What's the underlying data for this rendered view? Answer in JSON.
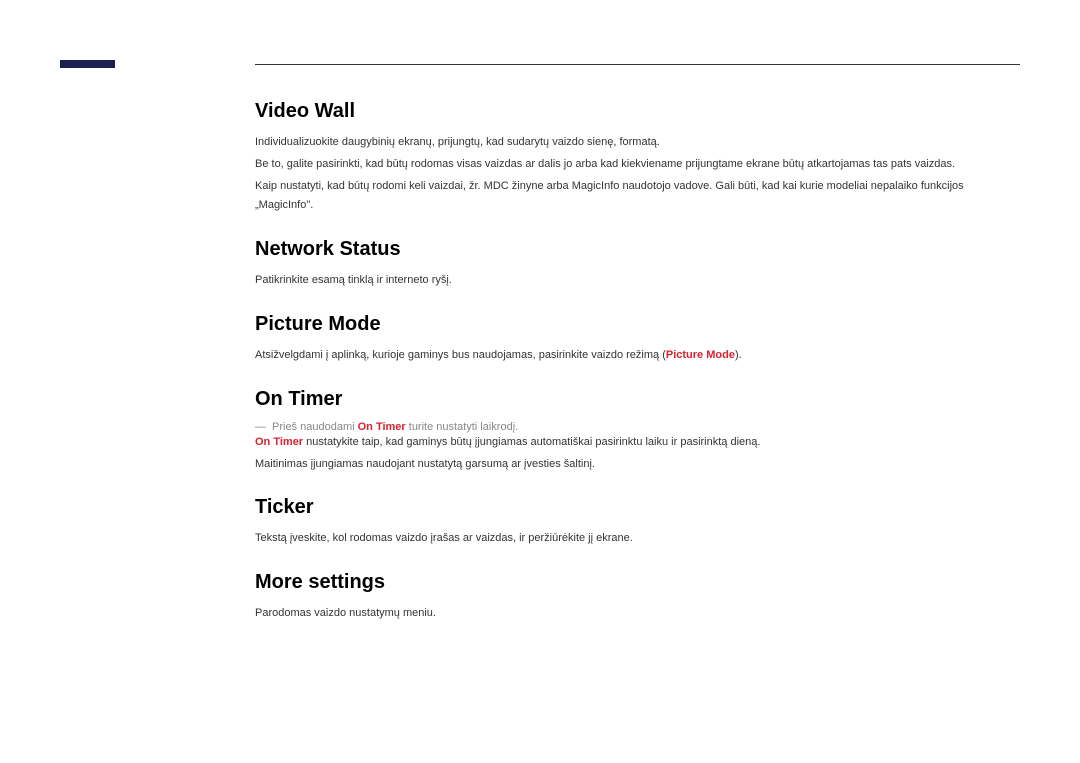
{
  "sections": {
    "videoWall": {
      "title": "Video Wall",
      "p1": "Individualizuokite daugybinių ekranų, prijungtų, kad sudarytų vaizdo sienę, formatą.",
      "p2": "Be to, galite pasirinkti, kad būtų rodomas visas vaizdas ar dalis jo arba kad kiekviename prijungtame ekrane būtų atkartojamas tas pats vaizdas.",
      "p3": "Kaip nustatyti, kad būtų rodomi keli vaizdai, žr. MDC žinyne arba MagicInfo naudotojo vadove. Gali būti, kad kai kurie modeliai nepalaiko funkcijos „MagicInfo\"."
    },
    "networkStatus": {
      "title": "Network Status",
      "p1": "Patikrinkite esamą tinklą ir interneto ryšį."
    },
    "pictureMode": {
      "title": "Picture Mode",
      "p1_part1": "Atsižvelgdami į aplinką, kurioje gaminys bus naudojamas, pasirinkite vaizdo režimą (",
      "p1_highlight": "Picture Mode",
      "p1_part2": ")."
    },
    "onTimer": {
      "title": "On Timer",
      "note_prefix": "Prieš naudodami ",
      "note_highlight": "On Timer",
      "note_suffix": " turite nustatyti laikrodį.",
      "p2_highlight": "On Timer",
      "p2_suffix": " nustatykite taip, kad gaminys būtų įjungiamas automatiškai pasirinktu laiku ir pasirinktą dieną.",
      "p3": "Maitinimas įjungiamas naudojant nustatytą garsumą ar įvesties šaltinį."
    },
    "ticker": {
      "title": "Ticker",
      "p1": "Tekstą įveskite, kol rodomas vaizdo įrašas ar vaizdas, ir peržiūrėkite jį ekrane."
    },
    "moreSettings": {
      "title": "More settings",
      "p1": "Parodomas vaizdo nustatymų meniu."
    }
  }
}
